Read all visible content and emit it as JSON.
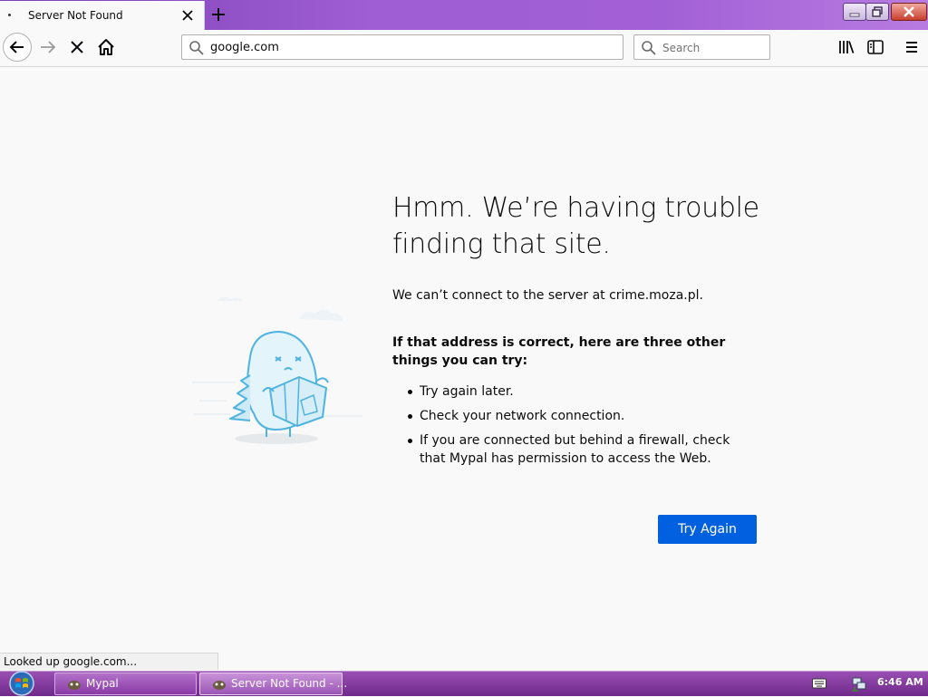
{
  "browser": {
    "tab": {
      "title": "Server Not Found"
    },
    "url": "google.com",
    "search_placeholder": "Search"
  },
  "error_page": {
    "title": "Hmm. We’re having trouble finding that site.",
    "description": "We can’t connect to the server at crime.moza.pl.",
    "suggestions_heading": "If that address is correct, here are three other things you can try:",
    "suggestions": [
      "Try again later.",
      "Check your network connection.",
      "If you are connected but behind a firewall, check that Mypal has permission to access the Web."
    ],
    "try_again_label": "Try Again"
  },
  "status_text": "Looked up google.com...",
  "taskbar": {
    "tasks": [
      {
        "label": "Mypal",
        "icon": "mypal-icon"
      },
      {
        "label": "Server Not Found - ...",
        "icon": "mypal-icon",
        "active": true
      }
    ],
    "clock": "6:46 AM"
  },
  "colors": {
    "accent_button": "#0060df",
    "page_background": "#f9f9fa",
    "title_bar_purple": "#9f5ed3",
    "illustration_blue": "#4fb3e0"
  }
}
